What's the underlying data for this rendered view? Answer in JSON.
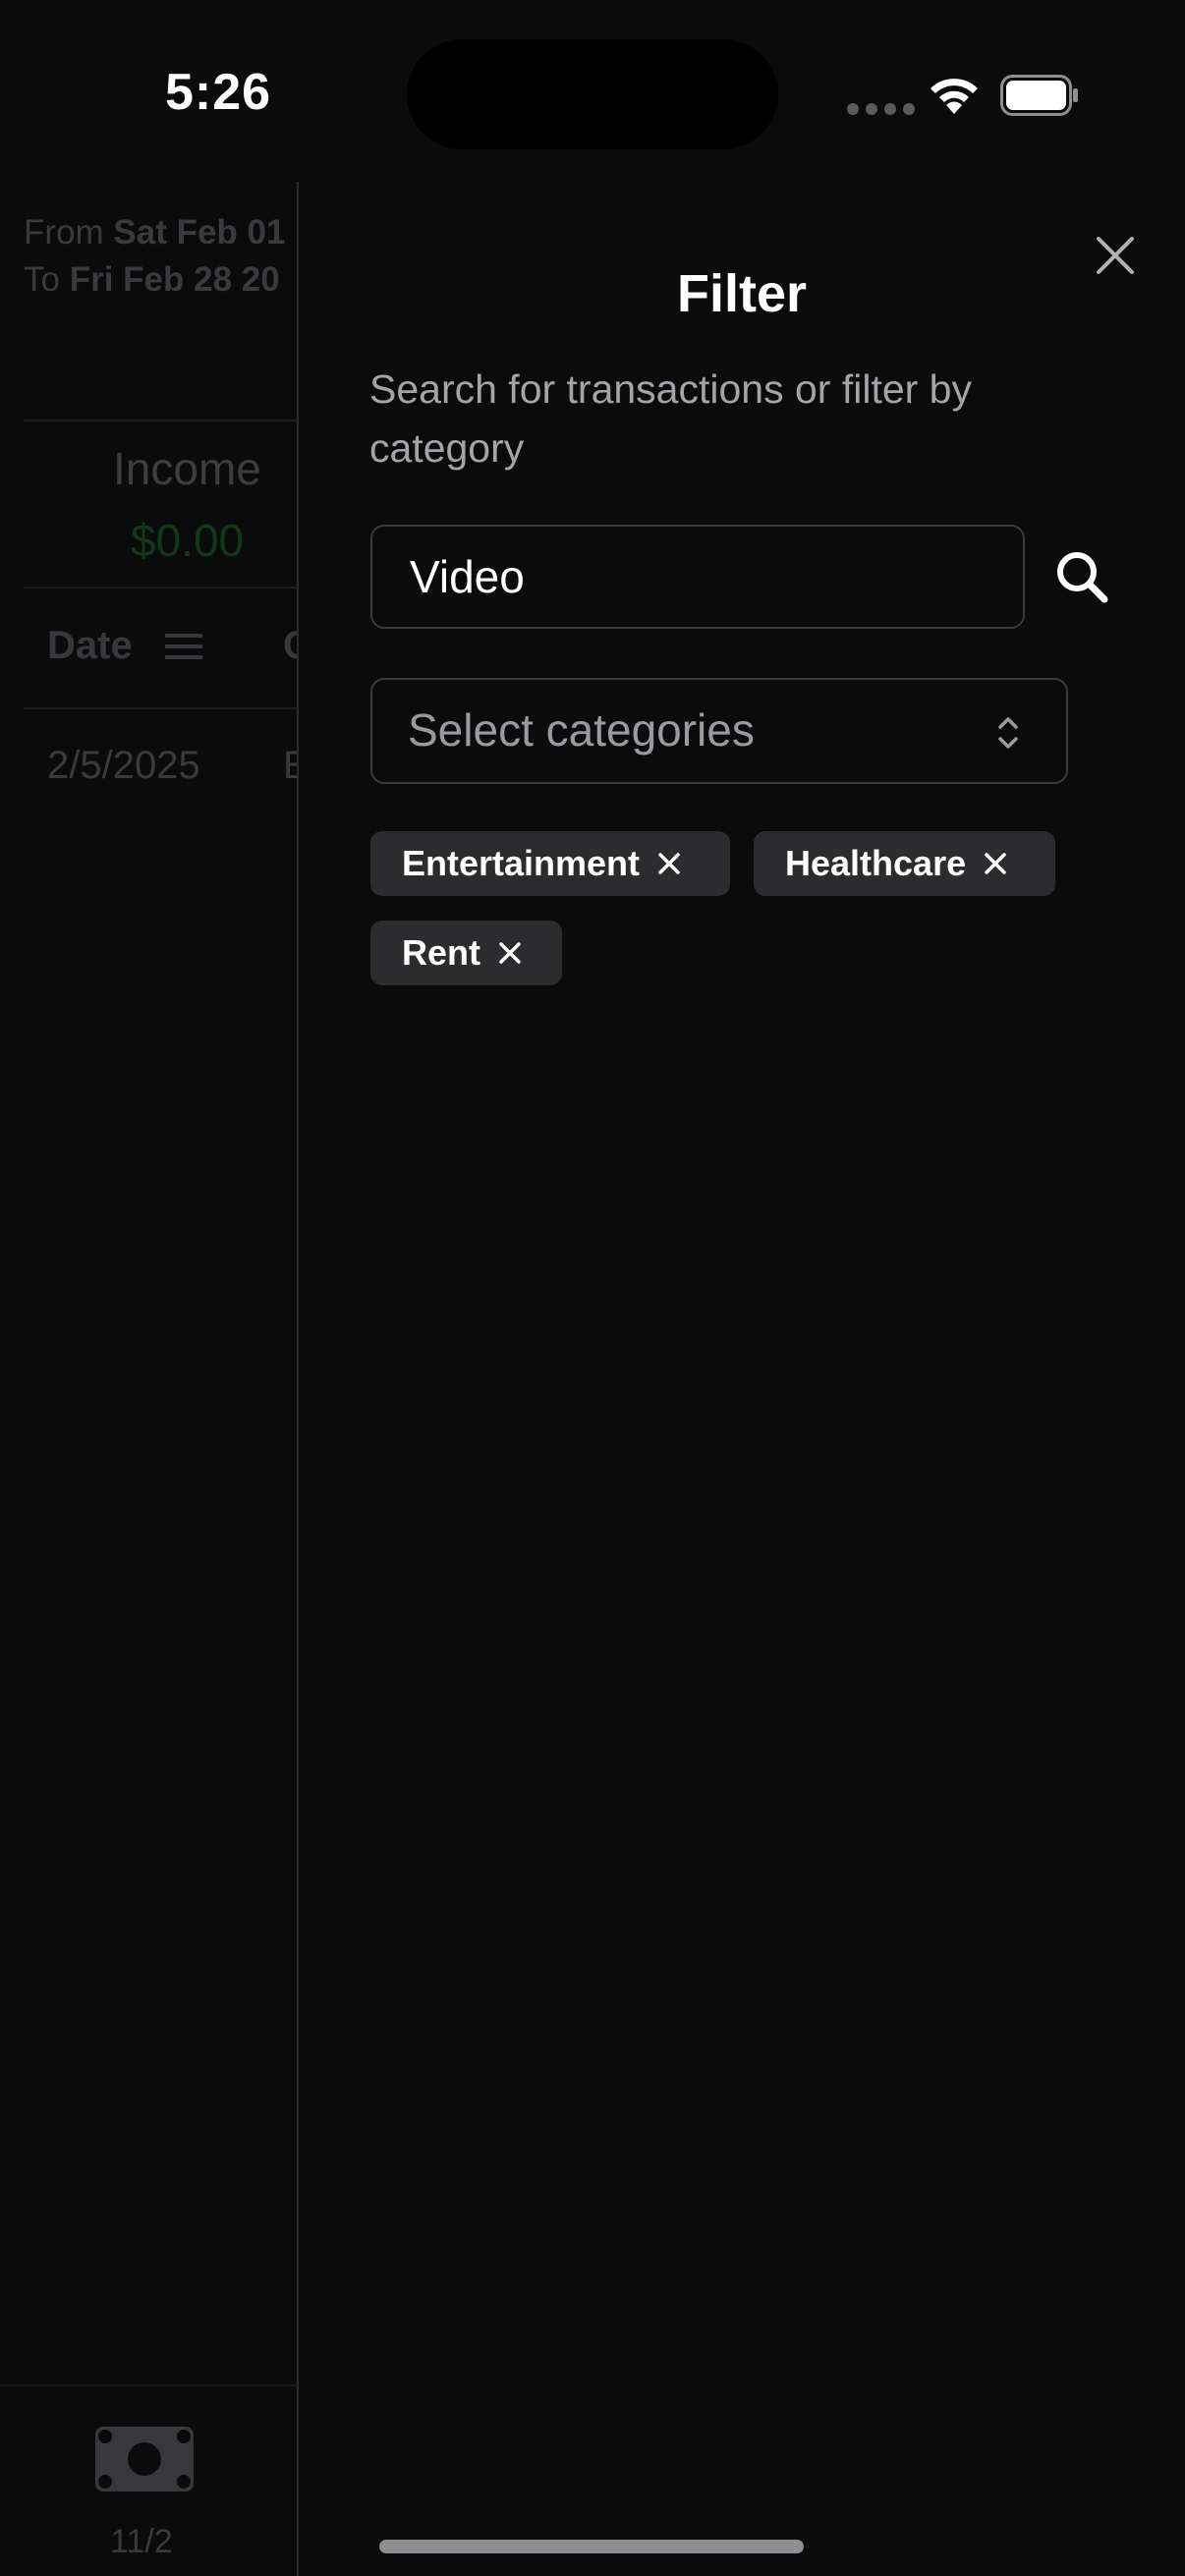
{
  "status_bar": {
    "time": "5:26"
  },
  "background": {
    "range": {
      "from_prefix": "From",
      "from_date": "Sat Feb 01",
      "to_prefix": "To",
      "to_date": "Fri Feb 28 20"
    },
    "income": {
      "label": "Income",
      "value": "$0.00",
      "value_color": "#0f3a1a"
    },
    "table": {
      "header_date": "Date",
      "header_c": "C",
      "row_date": "2/5/2025",
      "row_c": "E"
    },
    "tab": {
      "label": "11/2",
      "icon": "money-icon"
    }
  },
  "filter": {
    "title": "Filter",
    "subtitle": "Search for transactions or filter by category",
    "search": {
      "value": "Video"
    },
    "select": {
      "placeholder": "Select categories"
    },
    "tags": [
      "Entertainment",
      "Healthcare",
      "Rent"
    ]
  },
  "colors": {
    "background": "#0b0b0c",
    "tag_bg": "#2c2c2f",
    "subtitle": "#a3a3a8"
  }
}
